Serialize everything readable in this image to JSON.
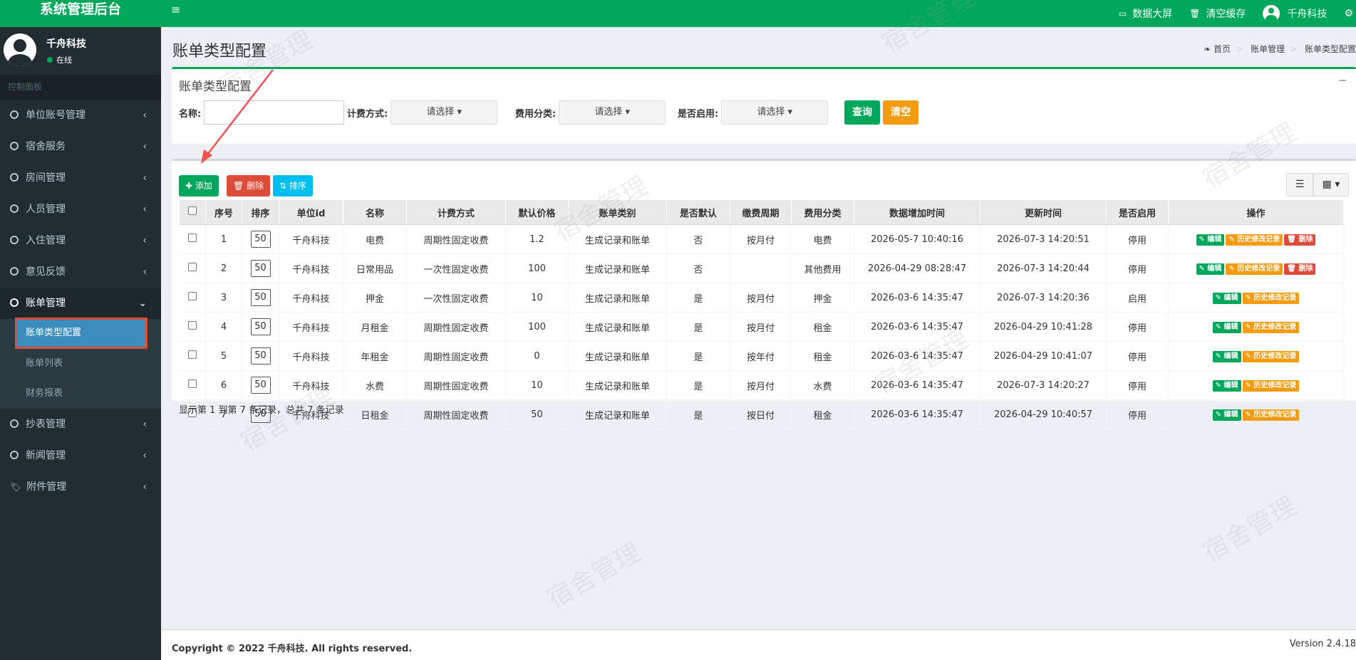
{
  "app": {
    "title": "系统管理后台"
  },
  "user": {
    "name": "千舟科技",
    "status": "在线"
  },
  "sidebar": {
    "header": "控制面板",
    "items": [
      {
        "label": "单位账号管理"
      },
      {
        "label": "宿舍服务"
      },
      {
        "label": "房间管理"
      },
      {
        "label": "人员管理"
      },
      {
        "label": "入住管理"
      },
      {
        "label": "意见反馈"
      },
      {
        "label": "账单管理"
      },
      {
        "label": "抄表管理"
      },
      {
        "label": "新闻管理"
      },
      {
        "label": "附件管理"
      }
    ],
    "sub": [
      "账单类型配置",
      "账单列表",
      "财务报表"
    ]
  },
  "topbar": {
    "data_screen": "数据大屏",
    "clear_cache": "清空缓存",
    "user": "千舟科技"
  },
  "page": {
    "title": "账单类型配置"
  },
  "breadcrumb": [
    "首页",
    "账单管理",
    "账单类型配置"
  ],
  "search": {
    "box_title": "账单类型配置",
    "name_label": "名称:",
    "billing_label": "计费方式:",
    "category_label": "费用分类:",
    "enabled_label": "是否启用:",
    "select_placeholder": "请选择",
    "query": "查询",
    "clear": "清空"
  },
  "toolbar": {
    "add": "添加",
    "delete": "删除",
    "sort": "排序"
  },
  "table": {
    "headers": [
      "序号",
      "排序",
      "单位id",
      "名称",
      "计费方式",
      "默认价格",
      "账单类别",
      "是否默认",
      "缴费周期",
      "费用分类",
      "数据增加时间",
      "更新时间",
      "是否启用",
      "操作"
    ],
    "rows": [
      [
        "1",
        "50",
        "千舟科技",
        "电费",
        "周期性固定收费",
        "1.2",
        "生成记录和账单",
        "否",
        "按月付",
        "电费",
        "2026-05-7 10:40:16",
        "2026-07-3 14:20:51",
        "停用"
      ],
      [
        "2",
        "50",
        "千舟科技",
        "日常用品",
        "一次性固定收费",
        "100",
        "生成记录和账单",
        "否",
        "",
        "其他费用",
        "2026-04-29 08:28:47",
        "2026-07-3 14:20:44",
        "停用"
      ],
      [
        "3",
        "50",
        "千舟科技",
        "押金",
        "一次性固定收费",
        "10",
        "生成记录和账单",
        "是",
        "按月付",
        "押金",
        "2026-03-6 14:35:47",
        "2026-07-3 14:20:36",
        "启用"
      ],
      [
        "4",
        "50",
        "千舟科技",
        "月租金",
        "周期性固定收费",
        "100",
        "生成记录和账单",
        "是",
        "按月付",
        "租金",
        "2026-03-6 14:35:47",
        "2026-04-29 10:41:28",
        "停用"
      ],
      [
        "5",
        "50",
        "千舟科技",
        "年租金",
        "周期性固定收费",
        "0",
        "生成记录和账单",
        "是",
        "按年付",
        "租金",
        "2026-03-6 14:35:47",
        "2026-04-29 10:41:07",
        "停用"
      ],
      [
        "6",
        "50",
        "千舟科技",
        "水费",
        "周期性固定收费",
        "10",
        "生成记录和账单",
        "是",
        "按月付",
        "水费",
        "2026-03-6 14:35:47",
        "2026-07-3 14:20:27",
        "停用"
      ],
      [
        "7",
        "50",
        "千舟科技",
        "日租金",
        "周期性固定收费",
        "50",
        "生成记录和账单",
        "是",
        "按日付",
        "租金",
        "2026-03-6 14:35:47",
        "2026-04-29 10:40:57",
        "停用"
      ]
    ],
    "op_edit": "编辑",
    "op_history": "历史修改记录",
    "op_delete": "删除",
    "summary": "显示第 1 到第 7 条记录，总共 7 条记录"
  },
  "footer": {
    "copyright": "Copyright © 2022 千舟科技. All rights reserved.",
    "version": "Version 2.4.18"
  },
  "watermark": "宿舍管理",
  "colors": {
    "primary": "#00a65a",
    "danger": "#dd4b39",
    "warning": "#f39c12",
    "info": "#00c0ef",
    "sidebar": "#222d32"
  }
}
